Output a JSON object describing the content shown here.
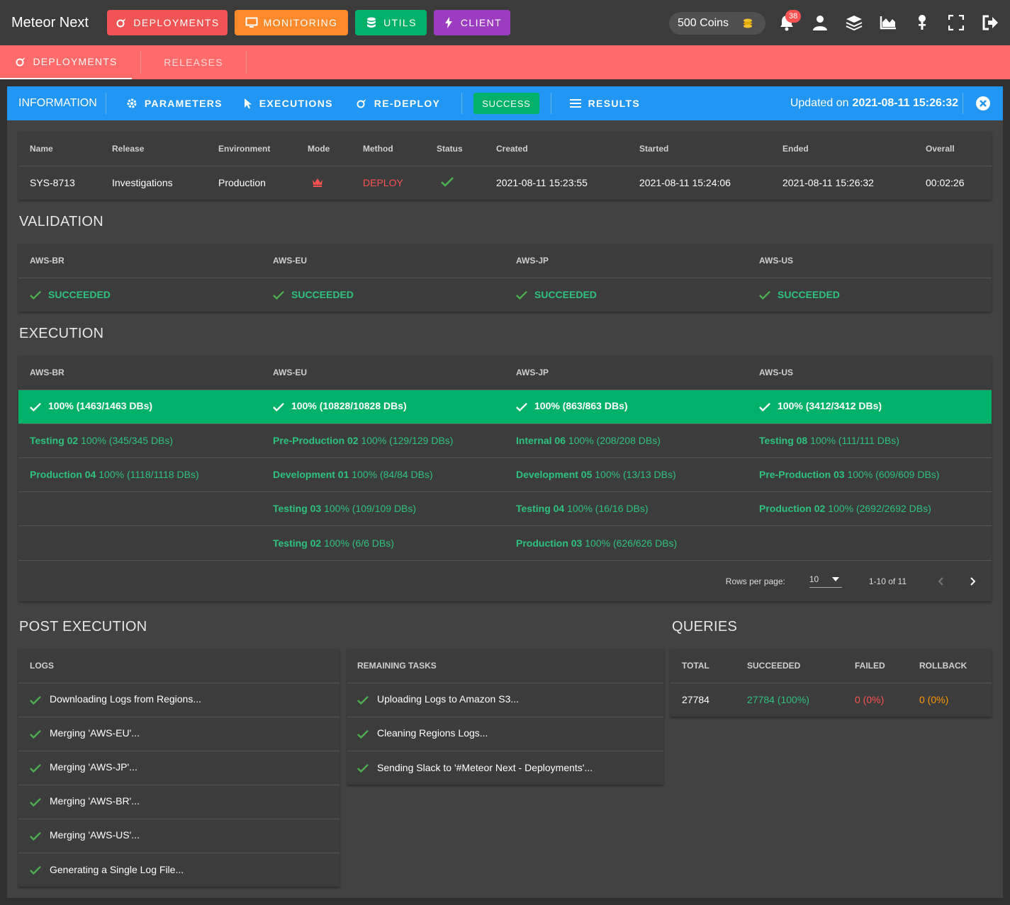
{
  "app": {
    "title": "Meteor Next",
    "nav": [
      {
        "label": "Deployments",
        "color": "#f05454",
        "icon": "rocket-icon"
      },
      {
        "label": "Monitoring",
        "color": "#ff8a2b",
        "icon": "monitor-icon"
      },
      {
        "label": "Utils",
        "color": "#00b16a",
        "icon": "database-icon"
      },
      {
        "label": "Client",
        "color": "#9c3cc0",
        "icon": "bolt-icon"
      }
    ],
    "coins": "500 Coins",
    "notifications": "38"
  },
  "tabs": [
    {
      "label": "Deployments",
      "icon": "rocket-icon"
    },
    {
      "label": "Releases"
    }
  ],
  "toolbar": {
    "title": "INFORMATION",
    "parameters": "PARAMETERS",
    "executions": "EXECUTIONS",
    "redeploy": "RE-DEPLOY",
    "status": "SUCCESS",
    "results": "RESULTS",
    "updated_prefix": "Updated on",
    "updated_value": "2021-08-11 15:26:32"
  },
  "info": {
    "headers": [
      "Name",
      "Release",
      "Environment",
      "Mode",
      "Method",
      "Status",
      "Created",
      "Started",
      "Ended",
      "Overall"
    ],
    "row": {
      "name": "SYS-8713",
      "release": "Investigations",
      "environment": "Production",
      "mode_icon": "crown-icon",
      "method": "DEPLOY",
      "status_icon": "check-icon",
      "created": "2021-08-11 15:23:55",
      "started": "2021-08-11 15:24:06",
      "ended": "2021-08-11 15:26:32",
      "overall": "00:02:26"
    }
  },
  "validation": {
    "title": "VALIDATION",
    "regions": [
      "AWS-BR",
      "AWS-EU",
      "AWS-JP",
      "AWS-US"
    ],
    "status": [
      "SUCCEEDED",
      "SUCCEEDED",
      "SUCCEEDED",
      "SUCCEEDED"
    ]
  },
  "execution": {
    "title": "EXECUTION",
    "regions": [
      "AWS-BR",
      "AWS-EU",
      "AWS-JP",
      "AWS-US"
    ],
    "totals": [
      "100% (1463/1463 DBs)",
      "100% (10828/10828 DBs)",
      "100% (863/863 DBs)",
      "100% (3412/3412 DBs)"
    ],
    "rows": [
      [
        {
          "env": "Testing 02",
          "val": "100% (345/345 DBs)"
        },
        {
          "env": "Pre-Production 02",
          "val": "100% (129/129 DBs)"
        },
        {
          "env": "Internal 06",
          "val": "100% (208/208 DBs)"
        },
        {
          "env": "Testing 08",
          "val": "100% (111/111 DBs)"
        }
      ],
      [
        {
          "env": "Production 04",
          "val": "100% (1118/1118 DBs)"
        },
        {
          "env": "Development 01",
          "val": "100% (84/84 DBs)"
        },
        {
          "env": "Development 05",
          "val": "100% (13/13 DBs)"
        },
        {
          "env": "Pre-Production 03",
          "val": "100% (609/609 DBs)"
        }
      ],
      [
        {
          "env": "",
          "val": ""
        },
        {
          "env": "Testing 03",
          "val": "100% (109/109 DBs)"
        },
        {
          "env": "Testing 04",
          "val": "100% (16/16 DBs)"
        },
        {
          "env": "Production 02",
          "val": "100% (2692/2692 DBs)"
        }
      ],
      [
        {
          "env": "",
          "val": ""
        },
        {
          "env": "Testing 02",
          "val": "100% (6/6 DBs)"
        },
        {
          "env": "Production 03",
          "val": "100% (626/626 DBs)"
        },
        {
          "env": "",
          "val": ""
        }
      ]
    ],
    "pager": {
      "rows_label": "Rows per page:",
      "rows_value": "10",
      "range": "1-10 of 11"
    }
  },
  "post": {
    "title": "POST EXECUTION",
    "logs_header": "LOGS",
    "logs": [
      "Downloading Logs from Regions...",
      "Merging 'AWS-EU'...",
      "Merging 'AWS-JP'...",
      "Merging 'AWS-BR'...",
      "Merging 'AWS-US'...",
      "Generating a Single Log File..."
    ],
    "tasks_header": "REMAINING TASKS",
    "tasks": [
      "Uploading Logs to Amazon S3...",
      "Cleaning Regions Logs...",
      "Sending Slack to '#Meteor Next - Deployments'..."
    ]
  },
  "queries": {
    "title": "QUERIES",
    "headers": [
      "TOTAL",
      "SUCCEEDED",
      "FAILED",
      "ROLLBACK"
    ],
    "total": "27784",
    "succeeded": "27784 (100%)",
    "failed": "0 (0%)",
    "rollback": "0 (0%)"
  }
}
